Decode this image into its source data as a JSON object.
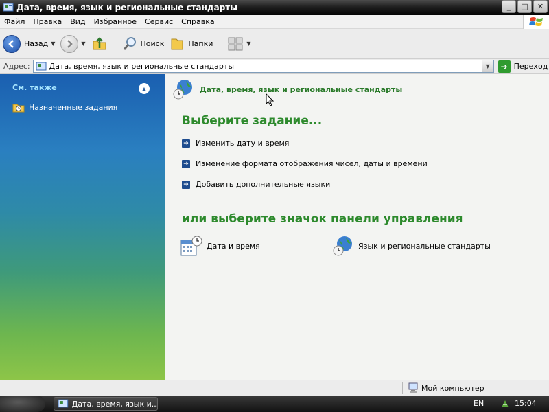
{
  "window": {
    "title": "Дата, время, язык и региональные стандарты",
    "minimize": "_",
    "maximize": "□",
    "close": "✕"
  },
  "menu": [
    "Файл",
    "Правка",
    "Вид",
    "Избранное",
    "Сервис",
    "Справка"
  ],
  "toolbar": {
    "back_label": "Назад",
    "search_label": "Поиск",
    "folders_label": "Папки"
  },
  "address": {
    "label": "Адрес:",
    "value": "Дата, время, язык и региональные стандарты",
    "go_label": "Переход"
  },
  "sidebar": {
    "header": "См. также",
    "items": [
      {
        "label": "Назначенные задания",
        "icon": "scheduled-tasks-icon"
      }
    ]
  },
  "main": {
    "category_title": "Дата, время, язык и региональные стандарты",
    "pick_task_title": "Выберите задание...",
    "tasks": [
      {
        "label": "Изменить дату и время"
      },
      {
        "label": "Изменение формата отображения чисел, даты и времени"
      },
      {
        "label": "Добавить дополнительные языки"
      }
    ],
    "pick_icon_title": "или выберите значок панели управления",
    "icons": [
      {
        "label": "Дата и время",
        "icon": "date-time-icon"
      },
      {
        "label": "Язык и региональные стандарты",
        "icon": "regional-settings-icon"
      }
    ]
  },
  "statusbar": {
    "computer_label": "Мой компьютер"
  },
  "taskbar": {
    "window_label": "Дата, время, язык и...",
    "language": "EN",
    "clock": "15:04"
  },
  "colors": {
    "accent_green": "#2d8a2d",
    "sidebar_header": "#a8e6ff",
    "link_blue": "#1e4c8e"
  }
}
